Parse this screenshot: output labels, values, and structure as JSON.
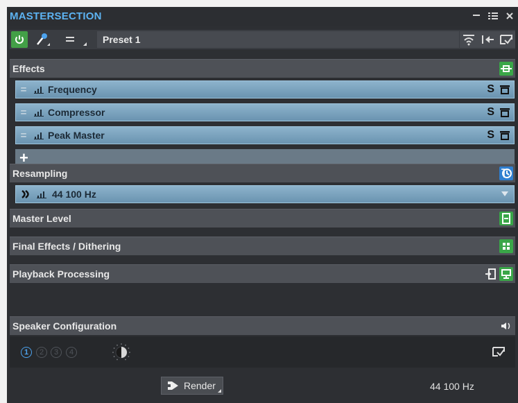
{
  "window": {
    "title": "MASTERSECTION"
  },
  "toolbar": {
    "preset_name": "Preset 1"
  },
  "effects": {
    "title": "Effects",
    "plugins": [
      {
        "name": "Frequency"
      },
      {
        "name": "Compressor"
      },
      {
        "name": "Peak Master"
      }
    ],
    "add_label": "+",
    "slot_solo_label": "S"
  },
  "resampling": {
    "title": "Resampling",
    "rate": "44 100 Hz"
  },
  "master_level": {
    "title": "Master Level"
  },
  "final_effects": {
    "title": "Final Effects / Dithering"
  },
  "playback": {
    "title": "Playback Processing"
  },
  "speaker": {
    "title": "Speaker Configuration",
    "configs": [
      "1",
      "2",
      "3",
      "4"
    ],
    "active_config": "1"
  },
  "bottom": {
    "render_label": "Render",
    "sample_rate": "44 100 Hz"
  },
  "colors": {
    "accent_blue": "#5db3f2",
    "slot_blue": "#7fa8c4",
    "green": "#3aa648",
    "icon_blue": "#2f7fd0"
  }
}
